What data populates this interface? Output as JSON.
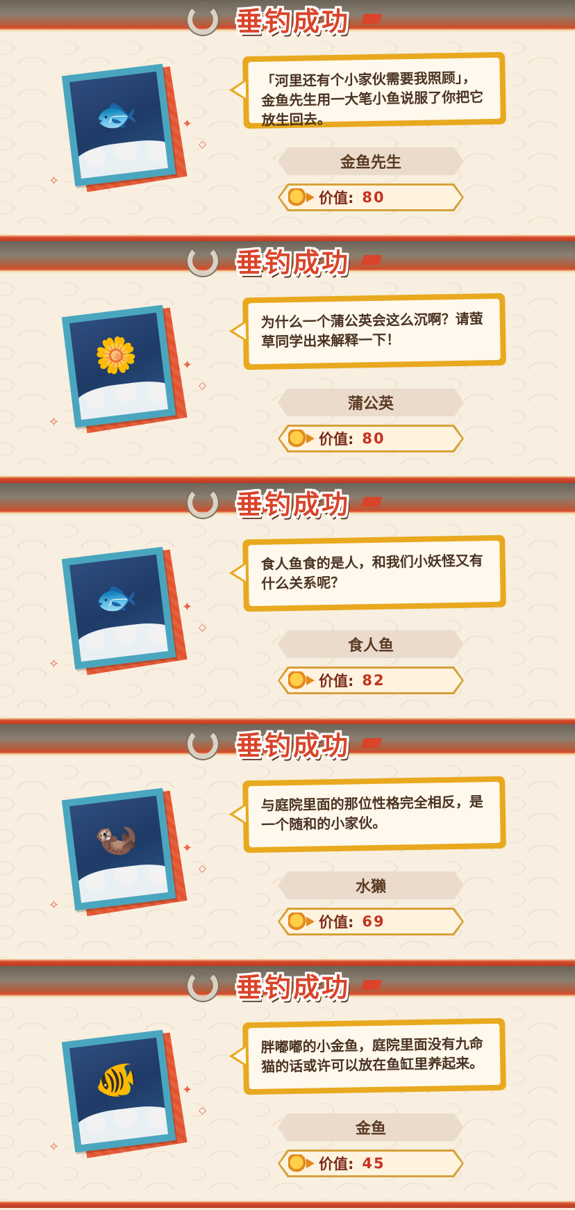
{
  "cards": [
    {
      "banner": "垂钓成功",
      "description": "「河里还有个小家伙需要我照顾」，金鱼先生用一大笔小鱼说服了你把它放生回去。",
      "name": "金鱼先生",
      "value_label": "价值:",
      "value": "80",
      "creature_icon": "goldfish-gentleman-icon",
      "accent": "#e2542f"
    },
    {
      "banner": "垂钓成功",
      "description": "为什么一个蒲公英会这么沉啊？请萤草同学出来解释一下！",
      "name": "蒲公英",
      "value_label": "价值:",
      "value": "80",
      "creature_icon": "dandelion-icon",
      "accent": "#e2542f"
    },
    {
      "banner": "垂钓成功",
      "description": "食人鱼食的是人，和我们小妖怪又有什么关系呢？",
      "name": "食人鱼",
      "value_label": "价值:",
      "value": "82",
      "creature_icon": "piranha-icon",
      "accent": "#e2542f"
    },
    {
      "banner": "垂钓成功",
      "description": "与庭院里面的那位性格完全相反，是一个随和的小家伙。",
      "name": "水獭",
      "value_label": "价值:",
      "value": "69",
      "creature_icon": "otter-icon",
      "accent": "#e2542f"
    },
    {
      "banner": "垂钓成功",
      "description": "胖嘟嘟的小金鱼，庭院里面没有九命猫的话或许可以放在鱼缸里养起来。",
      "name": "金鱼",
      "value_label": "价值:",
      "value": "45",
      "creature_icon": "goldfish-icon",
      "accent": "#e2542f"
    }
  ]
}
